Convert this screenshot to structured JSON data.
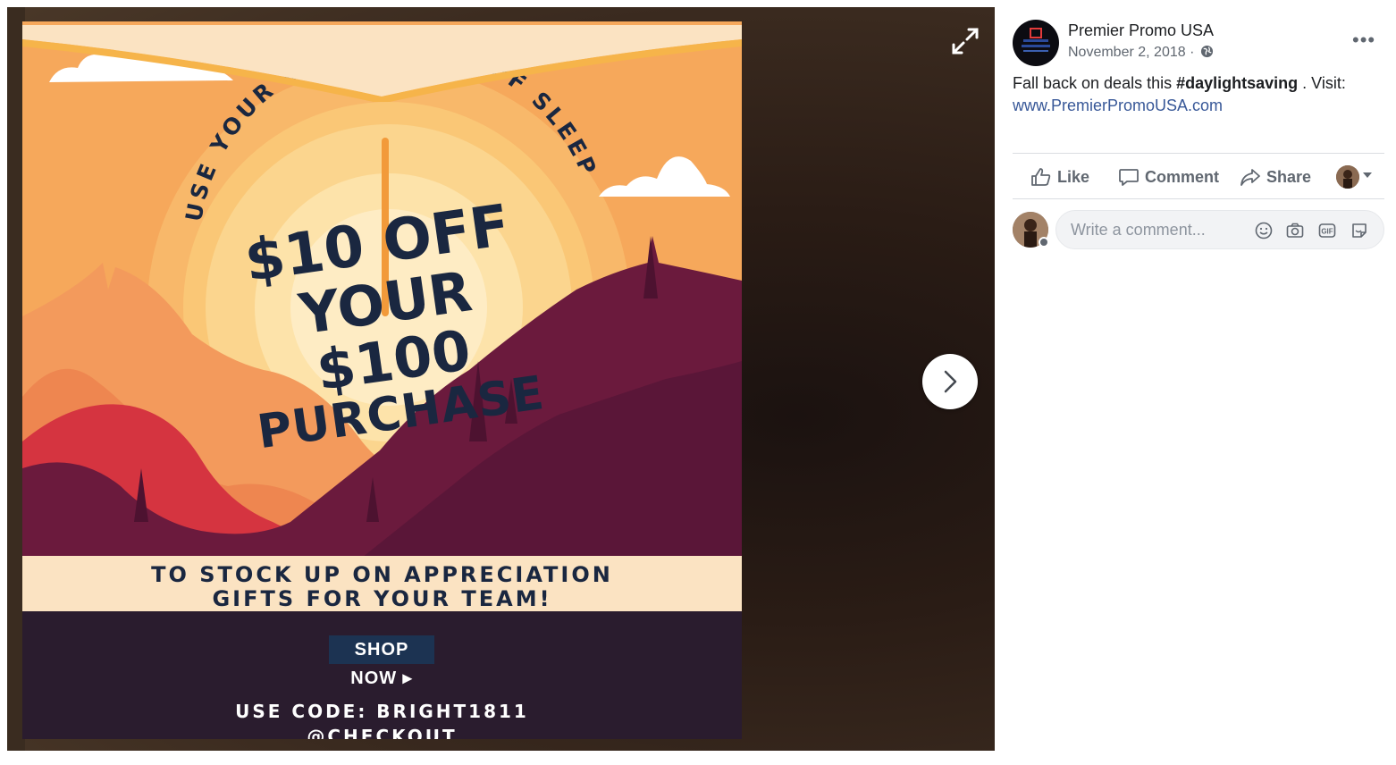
{
  "photo": {
    "arc_text": "USE YOUR EXTRA HOUR OF SLEEP",
    "headline_line1": "$10 OFF",
    "headline_line2": "YOUR $100",
    "headline_line3": "PURCHASE",
    "banner_line1": "TO STOCK UP ON APPRECIATION",
    "banner_line2": "GIFTS FOR YOUR TEAM!",
    "shop_button": "SHOP NOW ▸",
    "code_line1": "USE CODE: BRIGHT1811",
    "code_line2": "@CHECKOUT",
    "icons": [
      "expand-icon",
      "chevron-right-icon"
    ]
  },
  "post": {
    "page_name": "Premier Promo USA",
    "date": "November 2, 2018 ·",
    "text_before": "Fall back on deals this ",
    "hashtag": "#daylightsaving",
    "text_after": " . Visit:",
    "link": "www.PremierPromoUSA.com",
    "more": "•••"
  },
  "actions": {
    "like": "Like",
    "comment": "Comment",
    "share": "Share"
  },
  "comment_input": {
    "placeholder": "Write a comment..."
  },
  "colors": {
    "link": "#385898",
    "poster_orange": "#f6a75a",
    "navy": "#1a2740",
    "plum": "#5a1838"
  }
}
